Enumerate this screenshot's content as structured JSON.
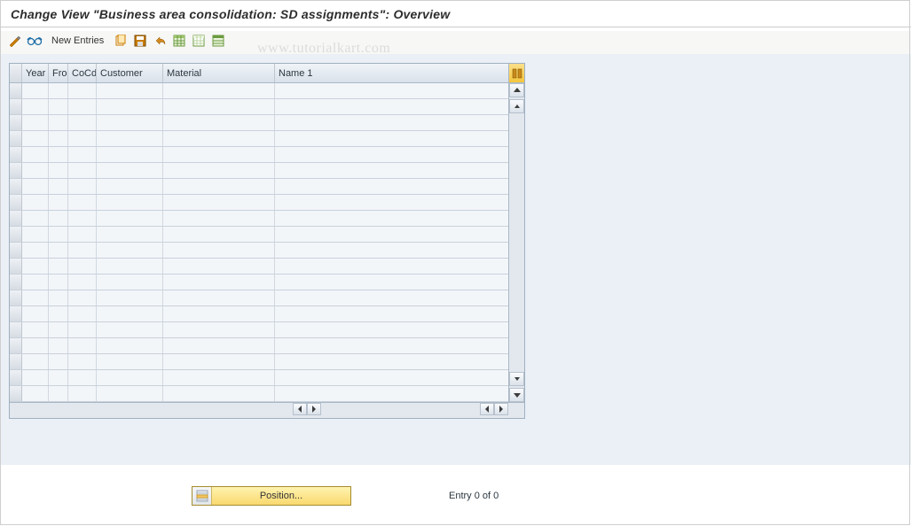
{
  "page": {
    "title": "Change View \"Business area consolidation: SD assignments\": Overview"
  },
  "toolbar": {
    "new_entries_label": "New Entries",
    "icons": {
      "display_change": "display-change-icon",
      "glasses": "glasses-icon",
      "copy": "copy-icon",
      "save": "save-icon",
      "undo": "undo-icon",
      "select_all": "select-all-icon",
      "deselect_all": "deselect-all-icon",
      "print": "print-icon"
    }
  },
  "watermark": "www.tutorialkart.com",
  "grid": {
    "columns": {
      "year": "Year",
      "fro": "Fro",
      "cocd": "CoCd",
      "customer": "Customer",
      "material": "Material",
      "name1": "Name 1"
    },
    "row_count": 20
  },
  "footer": {
    "position_label": "Position...",
    "entry_text": "Entry 0 of 0"
  }
}
